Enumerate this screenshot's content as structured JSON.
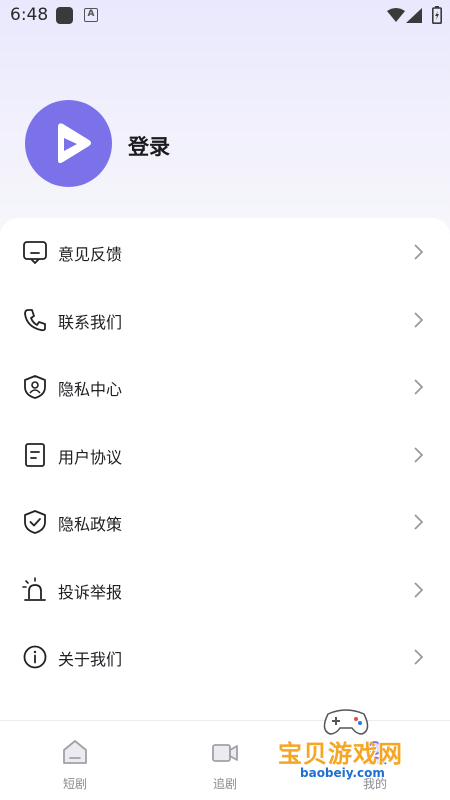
{
  "status_bar": {
    "time": "6:48",
    "icons": [
      "app-icon",
      "a-icon",
      "wifi-icon",
      "signal-icon",
      "battery-icon"
    ]
  },
  "profile": {
    "login_label": "登录",
    "avatar_icon": "play-logo-icon",
    "avatar_color": "#7b72ea"
  },
  "menu": {
    "items": [
      {
        "label": "意见反馈",
        "icon": "feedback-icon"
      },
      {
        "label": "联系我们",
        "icon": "phone-icon"
      },
      {
        "label": "隐私中心",
        "icon": "shield-user-icon"
      },
      {
        "label": "用户协议",
        "icon": "document-icon"
      },
      {
        "label": "隐私政策",
        "icon": "shield-check-icon"
      },
      {
        "label": "投诉举报",
        "icon": "alarm-icon"
      },
      {
        "label": "关于我们",
        "icon": "info-icon"
      }
    ]
  },
  "bottom_nav": {
    "tabs": [
      {
        "label": "短剧",
        "icon": "home-icon"
      },
      {
        "label": "追剧",
        "icon": "video-camera-icon"
      },
      {
        "label": "我的",
        "icon": "profile-icon"
      }
    ]
  },
  "watermark": {
    "text": "宝贝游戏网",
    "url": "baobeiy.com"
  }
}
